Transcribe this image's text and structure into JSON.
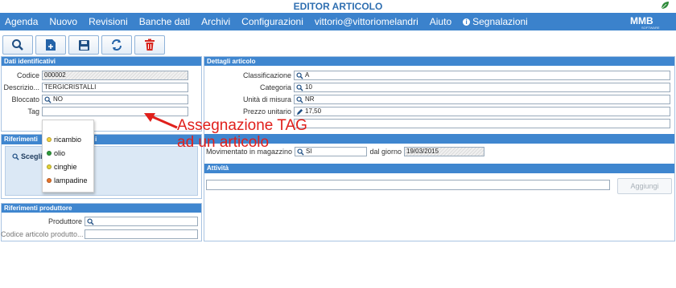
{
  "window": {
    "title": "EDITOR ARTICOLO"
  },
  "menu": {
    "items": [
      "Agenda",
      "Nuovo",
      "Revisioni",
      "Banche dati",
      "Archivi",
      "Configurazioni",
      "vittorio@vittoriomelandri",
      "Aiuto"
    ],
    "segnalazioni": "Segnalazioni"
  },
  "logo": {
    "name": "MMB",
    "sub": "SOFTWARE"
  },
  "toolbar": [
    "search-icon",
    "new-document-icon",
    "save-icon",
    "refresh-icon",
    "delete-icon"
  ],
  "dati_identificativi": {
    "header": "Dati identificativi",
    "codice_label": "Codice",
    "codice_value": "000002",
    "descrizione_label": "Descrizio...",
    "descrizione_value": "TERGICRISTALLI",
    "bloccato_label": "Bloccato",
    "bloccato_value": "NO",
    "tag_label": "Tag",
    "tag_value": ""
  },
  "riferimenti": {
    "header_start": "Riferimenti",
    "header_end": "i",
    "scegli": "Scegli"
  },
  "tag_options": [
    {
      "label": "ricambio",
      "color": "#f2d13a"
    },
    {
      "label": "olio",
      "color": "#2e9b3a"
    },
    {
      "label": "cinghie",
      "color": "#e3d234"
    },
    {
      "label": "lampadine",
      "color": "#e8742a"
    }
  ],
  "riferimenti_produttore": {
    "header": "Riferimenti produttore",
    "produttore_label": "Produttore",
    "produttore_value": "",
    "codice_label": "Codice articolo produtto...",
    "codice_value": ""
  },
  "dettagli": {
    "header": "Dettagli articolo",
    "classificazione_label": "Classificazione",
    "classificazione_value": "A",
    "categoria_label": "Categoria",
    "categoria_value": "10",
    "unita_label": "Unità di misura",
    "unita_value": "NR",
    "prezzo_label": "Prezzo unitario",
    "prezzo_value": "17,50"
  },
  "magazzino": {
    "movimentato_label": "Movimentato in magazzino",
    "movimentato_value": "SI",
    "dal_giorno_label": "dal giorno",
    "dal_giorno_value": "19/03/2015"
  },
  "attivita": {
    "header": "Attività",
    "input_value": "",
    "aggiungi": "Aggiungi"
  },
  "annotation": {
    "line1": "Assegnazione TAG",
    "line2": "ad un articolo"
  },
  "colors": {
    "menu_bg": "#3b82cc",
    "panel_header": "#3f86cf",
    "annotation": "#e0201c",
    "title": "#2f6fb1"
  }
}
